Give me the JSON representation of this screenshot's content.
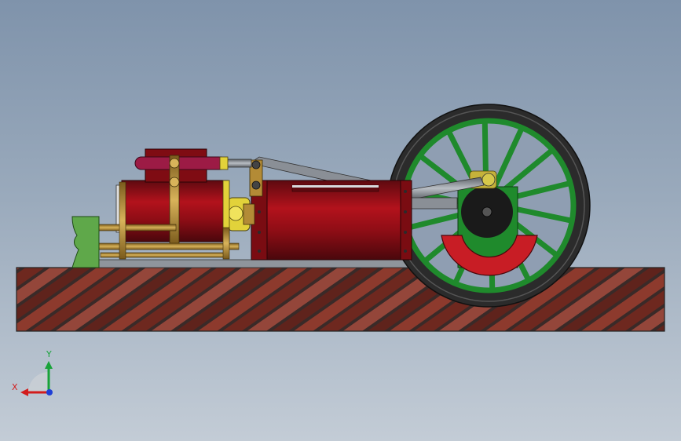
{
  "viewport": {
    "background_top": "#7f93ab",
    "background_bottom": "#c3ccd6"
  },
  "model": {
    "base_color": "#6e2a22",
    "brick_mortar": "#3a2a28",
    "body_red": "#a3121a",
    "body_red_dark": "#5e0a10",
    "brass": "#b38b36",
    "yellow": "#e2d23a",
    "green": "#1f8a2c",
    "light_green": "#5fa84a",
    "steel": "#8a8f96",
    "tire": "#2b2b2b"
  },
  "triad": {
    "y_label": "Y",
    "x_label": "X",
    "y_color": "#19a33a",
    "x_color": "#d21c1c",
    "z_color": "#1f3fd6"
  }
}
